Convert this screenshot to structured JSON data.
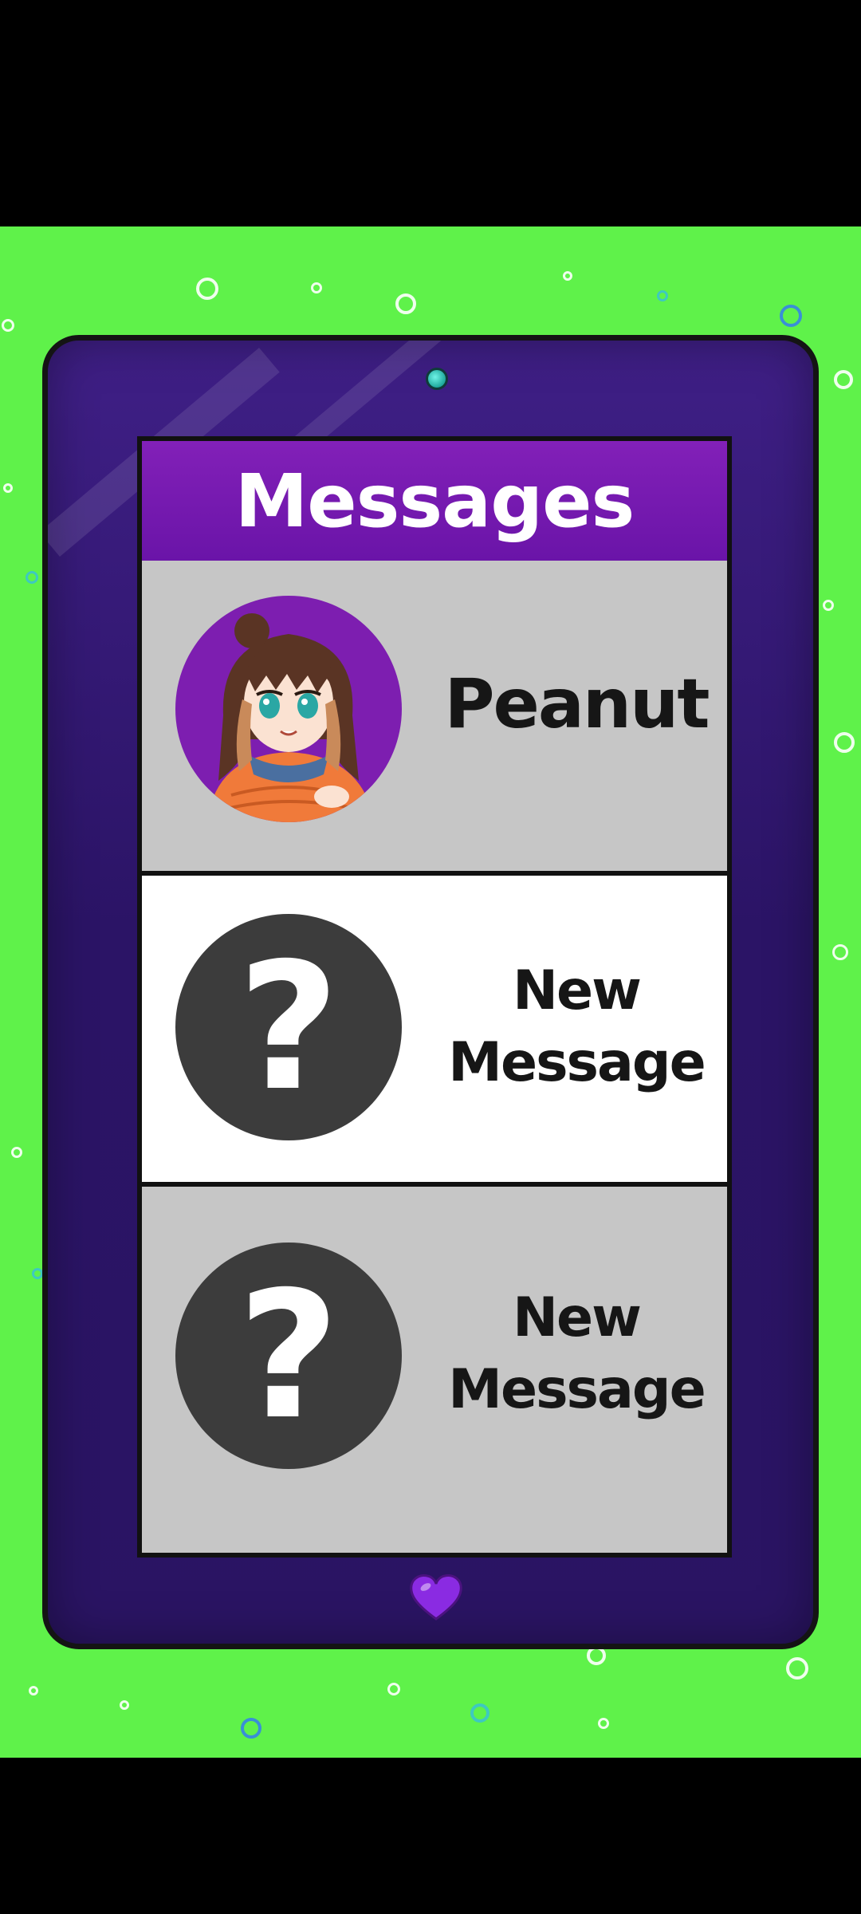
{
  "screen": {
    "title": "Messages"
  },
  "conversations": [
    {
      "label_lines": [
        "Peanut"
      ],
      "avatar": "anime-girl-avatar",
      "highlighted": false
    },
    {
      "label_lines": [
        "New",
        "Message"
      ],
      "avatar": "question-mark-icon",
      "highlighted": true
    },
    {
      "label_lines": [
        "New",
        "Message"
      ],
      "avatar": "question-mark-icon",
      "highlighted": false
    }
  ],
  "icons": {
    "unknown_contact": "?",
    "home_button": "heart-icon"
  },
  "colors": {
    "background": "#5ff24a",
    "device": "#2b1466",
    "header": "#7a1cb4",
    "row_gray": "#c6c6c6",
    "row_highlight": "#ffffff",
    "avatar_unknown": "#3c3c3c",
    "heart": "#8a2be2"
  }
}
